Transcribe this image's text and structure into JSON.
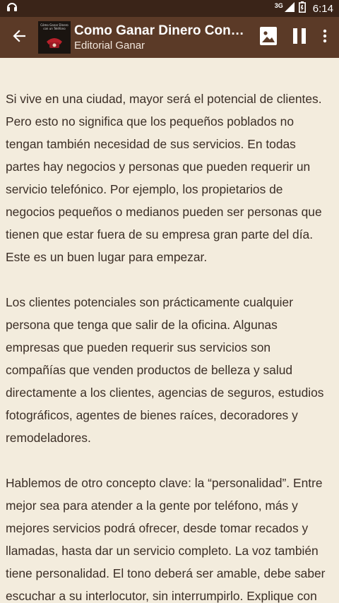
{
  "status_bar": {
    "network": "3G",
    "time": "6:14"
  },
  "app_bar": {
    "title": "Como Ganar Dinero Con…",
    "subtitle": "Editorial Ganar",
    "cover_text": "Cómo Ganar Dinero con un Teléfono"
  },
  "content": {
    "paragraphs": [
      "Si vive en una ciudad, mayor será el potencial de clientes. Pero esto no significa que los pequeños poblados no tengan también necesidad de sus servicios. En todas partes hay negocios y personas que pueden requerir un servicio telefónico. Por ejemplo, los propietarios de negocios pequeños o medianos pueden ser personas que tienen que estar fuera de su empresa gran parte del día. Este es un buen lugar para empezar.",
      "Los clientes potenciales son prácticamente cualquier persona que tenga que salir de la oficina. Algunas empresas que pueden requerir sus servicios son compañías que venden productos de belleza y salud directamente a los clientes, agencias de seguros, estudios fotográficos, agentes de bienes raíces, decoradores y remodeladores.",
      "Hablemos de otro concepto clave: la “personalidad”. Entre mejor sea para atender a la gente por teléfono, más y mejores servicios podrá ofrecer, desde tomar recados y llamadas, hasta dar un servicio completo. La voz también tiene personalidad. El tono deberá ser amable, debe saber escuchar a su interlocutor, sin interrumpirlo. Explique con"
    ]
  },
  "colors": {
    "status_bar": "#3a2418",
    "app_bar": "#5b3a27",
    "background": "#f3ecdd",
    "text": "#3b2e26"
  }
}
